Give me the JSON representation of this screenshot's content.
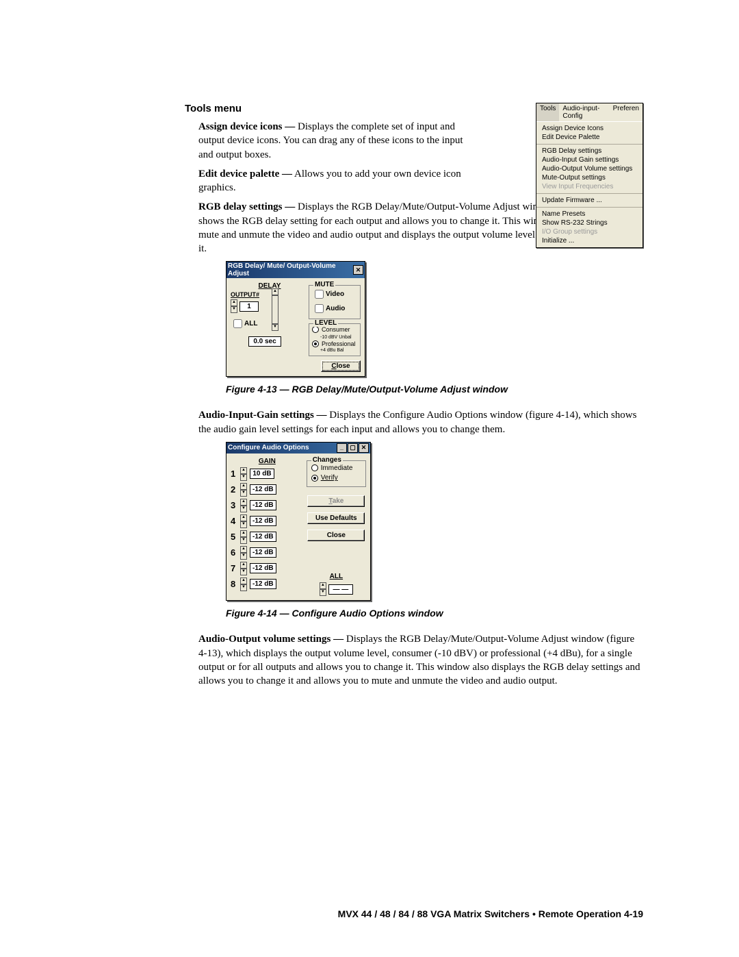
{
  "heading": "Tools menu",
  "defs": {
    "assign": {
      "term": "Assign device icons —",
      "text": " Displays the complete set of input and output device icons.  You can drag any of these icons to the input and output boxes."
    },
    "edit": {
      "term": "Edit device palette —",
      "text": " Allows you to add your own device icon graphics."
    },
    "rgb": {
      "term": "RGB delay settings —",
      "text": " Displays the RGB Delay/Mute/Output-Volume Adjust window (figure 4-13), which shows the RGB delay setting for each output and allows you to change it.  This window also allows you to mute and unmute the video and audio output and displays the output volume level and allows you to change it."
    },
    "audioIn": {
      "term": "Audio-Input-Gain settings —",
      "text": " Displays the Configure Audio Options window (figure 4-14), which shows the audio gain level settings for each input and allows you to change them."
    },
    "audioOut": {
      "term": "Audio-Output volume settings —",
      "text": " Displays the RGB Delay/Mute/Output-Volume Adjust window (figure 4-13), which displays the output volume level, consumer (-10 dBV) or professional (+4 dBu), for a single output or for all outputs and allows you to change it.  This window also displays the RGB delay settings and allows you to change it and allows you to mute and unmute the video and audio output."
    }
  },
  "toolsMenu": {
    "bar": {
      "tools": "Tools",
      "audio": "Audio-input-Config",
      "pref": "Preferen"
    },
    "grp1": [
      "Assign Device Icons",
      "Edit Device Palette"
    ],
    "grp2": [
      "RGB Delay settings",
      "Audio-Input Gain settings",
      "Audio-Output Volume settings",
      "Mute-Output settings"
    ],
    "grp2d": "View Input Frequencies",
    "grp3": [
      "Update Firmware ..."
    ],
    "grp4": [
      "Name Presets",
      "Show RS-232 Strings"
    ],
    "grp4d": "I/O Group settings",
    "grp4b": "Initialize ..."
  },
  "dlgRgb": {
    "title": "RGB Delay/ Mute/ Output-Volume Adjust",
    "delay": "DELAY",
    "output": "OUTPUT#",
    "outVal": "1",
    "all": "ALL",
    "secVal": "0.0 sec",
    "mute": "MUTE",
    "video": "Video",
    "audio": "Audio",
    "level": "LEVEL",
    "consumer": "Consumer",
    "consumerSub": "-10 dBV Unbal",
    "professional": "Professional",
    "professionalSub": "+4 dBu Bal",
    "close": "Close"
  },
  "dlgAudio": {
    "title": "Configure Audio Options",
    "gain": "GAIN",
    "rows": [
      {
        "n": "1",
        "v": "10 dB"
      },
      {
        "n": "2",
        "v": "-12 dB"
      },
      {
        "n": "3",
        "v": "-12 dB"
      },
      {
        "n": "4",
        "v": "-12 dB"
      },
      {
        "n": "5",
        "v": "-12 dB"
      },
      {
        "n": "6",
        "v": "-12 dB"
      },
      {
        "n": "7",
        "v": "-12 dB"
      },
      {
        "n": "8",
        "v": "-12 dB"
      }
    ],
    "changes": "Changes",
    "immediate": "Immediate",
    "verify": "Verify",
    "take": "Take",
    "defaults": "Use Defaults",
    "close": "Close",
    "all": "ALL",
    "allVal": "— —"
  },
  "fig13": "Figure 4-13 — RGB Delay/Mute/Output-Volume Adjust window",
  "fig14": "Figure 4-14 — Configure Audio Options window",
  "footer": "MVX 44 / 48 / 84 / 88 VGA Matrix Switchers • Remote Operation    4-19"
}
